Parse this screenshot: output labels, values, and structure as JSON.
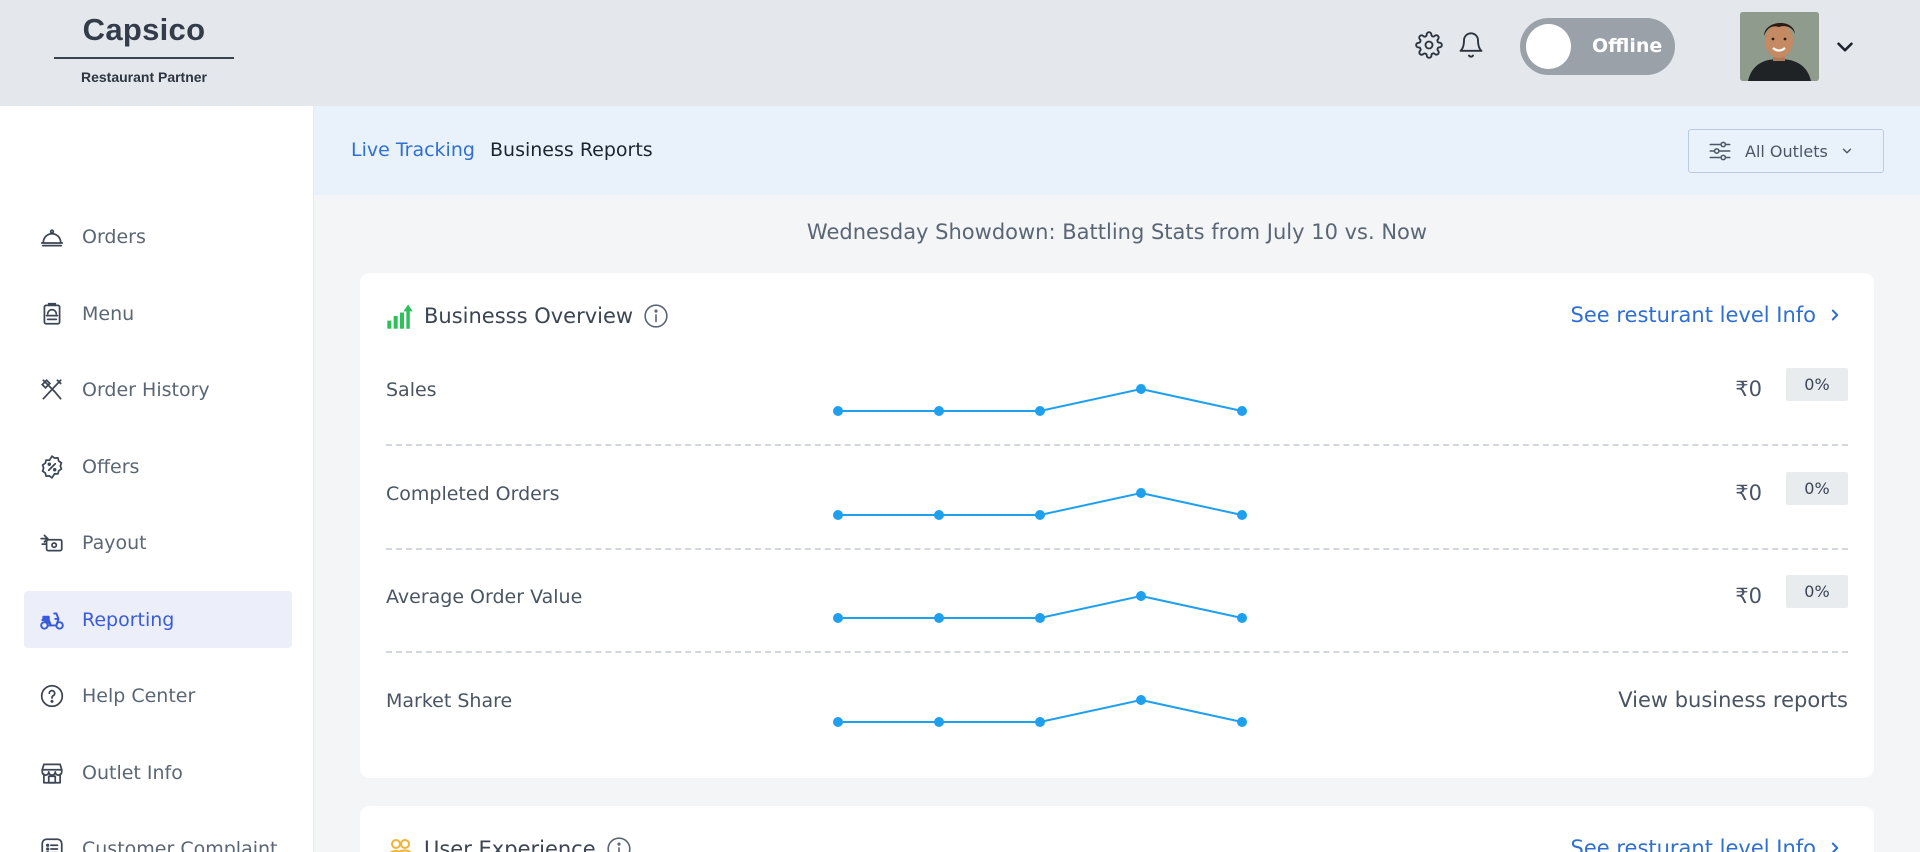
{
  "header": {
    "brand_name": "Capsico",
    "brand_tagline": "Restaurant Partner",
    "status_label": "Offline"
  },
  "sidebar": {
    "items": [
      {
        "label": "Orders",
        "icon": "cloche-icon"
      },
      {
        "label": "Menu",
        "icon": "menu-icon"
      },
      {
        "label": "Order History",
        "icon": "utensils-icon"
      },
      {
        "label": "Offers",
        "icon": "discount-badge-icon"
      },
      {
        "label": "Payout",
        "icon": "payout-icon"
      },
      {
        "label": "Reporting",
        "icon": "scooter-icon",
        "active": true
      },
      {
        "label": "Help Center",
        "icon": "help-icon"
      },
      {
        "label": "Outlet Info",
        "icon": "store-icon"
      },
      {
        "label": "Customer Complaint",
        "icon": "complaint-icon"
      }
    ]
  },
  "subbar": {
    "live_tracking": "Live Tracking",
    "business_reports": "Business Reports",
    "outlets_filter": "All Outlets"
  },
  "showdown_title": "Wednesday Showdown: Battling Stats from July 10 vs. Now",
  "overview": {
    "title": "Businesss Overview",
    "see_link": "See resturant level Info",
    "metrics": [
      {
        "label": "Sales",
        "value": "₹0",
        "change": "0%"
      },
      {
        "label": "Completed Orders",
        "value": "₹0",
        "change": "0%"
      },
      {
        "label": "Average Order Value",
        "value": "₹0",
        "change": "0%"
      },
      {
        "label": "Market Share",
        "link": "View business reports"
      }
    ]
  },
  "user_experience": {
    "title": "User Experience",
    "see_link": "See resturant level Info"
  },
  "colors": {
    "accent": "#2f6fd1",
    "sparkline": "#1ea0ef",
    "overview_icon": "#2ec05a",
    "ux_icon": "#f2b236"
  }
}
